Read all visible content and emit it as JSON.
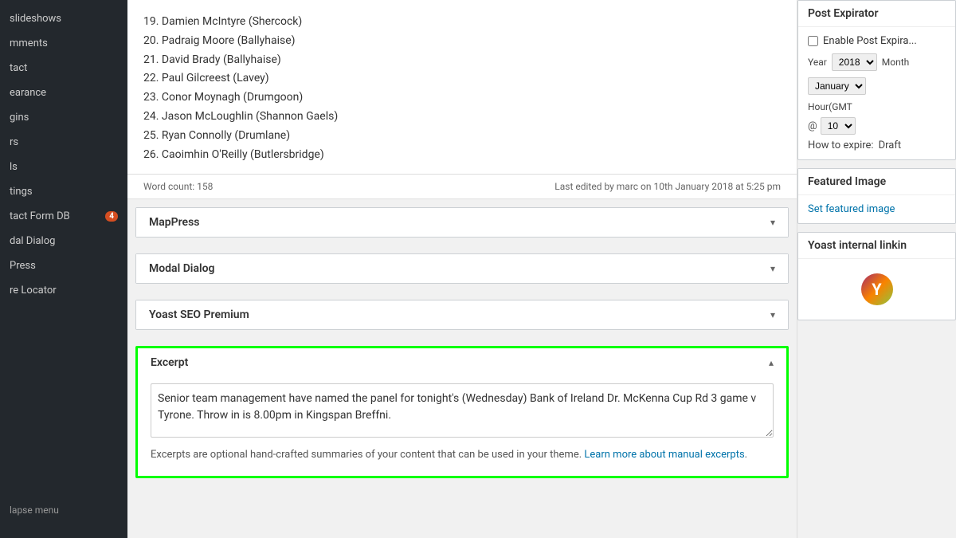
{
  "sidebar": {
    "items": [
      {
        "label": "slideshows",
        "id": "slideshows"
      },
      {
        "label": "mments",
        "id": "comments"
      },
      {
        "label": "tact",
        "id": "contact"
      },
      {
        "label": "earance",
        "id": "appearance"
      },
      {
        "label": "gins",
        "id": "plugins"
      },
      {
        "label": "rs",
        "id": "users"
      },
      {
        "label": "ls",
        "id": "tools"
      },
      {
        "label": "tings",
        "id": "settings"
      }
    ],
    "badge_item": {
      "label": "tact Form DB",
      "badge": "4"
    },
    "extra_items": [
      {
        "label": "dal Dialog",
        "id": "modal-dialog"
      },
      {
        "label": "Press",
        "id": "press"
      },
      {
        "label": "re Locator",
        "id": "store-locator"
      }
    ],
    "collapse_label": "lapse menu"
  },
  "content": {
    "lines": [
      "19. Damien McIntyre (Shercock)",
      "20. Padraig Moore (Ballyhaise)",
      "21. David Brady (Ballyhaise)",
      "22. Paul Gilcreest (Lavey)",
      "23. Conor Moynagh (Drumgoon)",
      "24. Jason McLoughlin (Shannon Gaels)",
      "25. Ryan Connolly (Drumlane)",
      "26. Caoimhin O'Reilly (Butlersbridge)"
    ],
    "word_count": "Word count: 158",
    "last_edited": "Last edited by marc on 10th January 2018 at 5:25 pm"
  },
  "metaboxes": [
    {
      "id": "mappress",
      "label": "MapPress",
      "collapsed": true
    },
    {
      "id": "modal-dialog",
      "label": "Modal Dialog",
      "collapsed": true
    },
    {
      "id": "yoast-seo",
      "label": "Yoast SEO Premium",
      "collapsed": true
    }
  ],
  "excerpt": {
    "header_label": "Excerpt",
    "textarea_value": "Senior team management have named the panel for tonight's (Wednesday) Bank of Ireland Dr. McKenna Cup Rd 3 game v Tyrone. Throw in is 8.00pm in Kingspan Breffni.",
    "help_text": "Excerpts are optional hand-crafted summaries of your content that can be used in your theme.",
    "learn_more_label": "Learn more about manual excerpts",
    "learn_more_href": "#"
  },
  "right_sidebar": {
    "post_expirator": {
      "header": "Post Expirator",
      "enable_label": "Enable Post Expira...",
      "year_label": "Year",
      "month_label": "Month",
      "year_value": "2018",
      "month_value": "January",
      "hour_label": "Hour(GMT",
      "hour_value": "10",
      "at_symbol": "@",
      "how_label": "How to expire:",
      "how_value": "Draft"
    },
    "featured_image": {
      "header": "Featured Image",
      "set_label": "Set featured image"
    },
    "yoast_internal": {
      "header": "Yoast internal linkin"
    }
  },
  "chevron_down": "▾",
  "chevron_up": "▴"
}
